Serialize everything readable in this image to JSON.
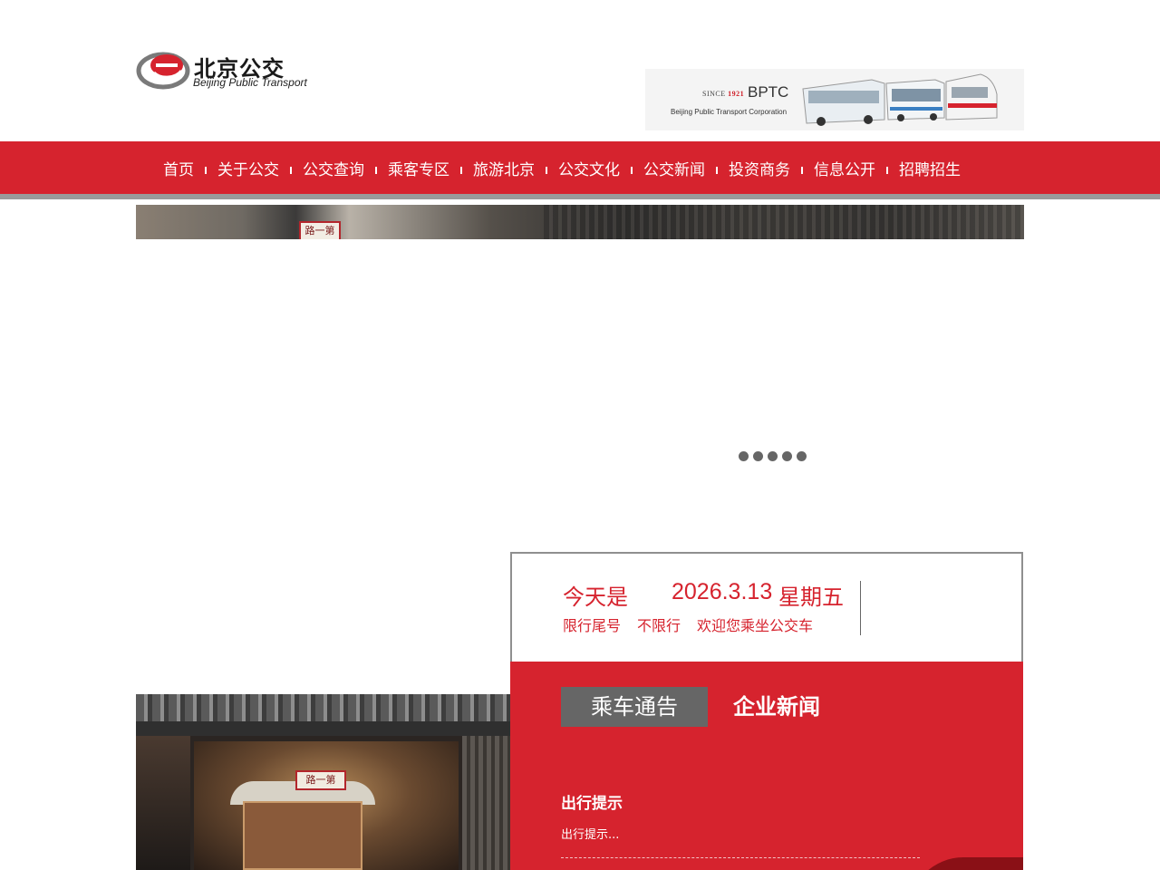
{
  "header": {
    "logo_cn": "北京公交",
    "logo_en": "Beijing Public Transport",
    "banner": {
      "since_prefix": "SINCE ",
      "since_year": "1921",
      "abbr": "BPTC",
      "corp_full": "Beijing Public Transport Corporation"
    }
  },
  "nav": {
    "items": [
      {
        "label": "首页"
      },
      {
        "label": "关于公交"
      },
      {
        "label": "公交查询"
      },
      {
        "label": "乘客专区"
      },
      {
        "label": "旅游北京"
      },
      {
        "label": "公交文化"
      },
      {
        "label": "公交新闻"
      },
      {
        "label": "投资商务"
      },
      {
        "label": "信息公开"
      },
      {
        "label": "招聘招生"
      }
    ]
  },
  "hero": {
    "sign_text": "路一第",
    "slide_count": 5
  },
  "photo": {
    "sign_text": "路一第"
  },
  "info": {
    "today_label": "今天是",
    "date": "2026.3.13",
    "weekday": "星期五",
    "restriction_label": "限行尾号",
    "restriction_value": "不限行",
    "welcome": "欢迎您乘坐公交车"
  },
  "news": {
    "tab_active": "乘车通告",
    "tab_inactive": "企业新闻",
    "item_title": "出行提示",
    "item_desc": "出行提示..."
  },
  "colors": {
    "brand_red": "#d6232e",
    "tab_gray": "#666666",
    "nav_border": "#9a9a9a"
  }
}
